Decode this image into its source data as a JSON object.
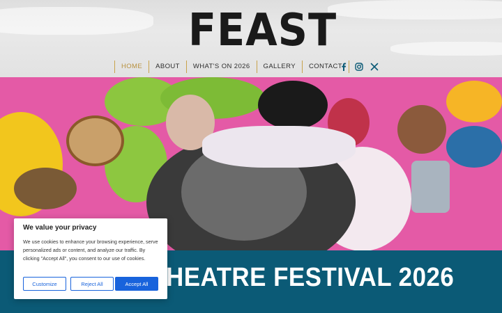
{
  "logo": {
    "text": "FEAST"
  },
  "nav": {
    "items": [
      {
        "label": "HOME",
        "active": true
      },
      {
        "label": "ABOUT"
      },
      {
        "label": "WHAT'S ON 2026"
      },
      {
        "label": "GALLERY"
      },
      {
        "label": "CONTACT"
      }
    ],
    "accent_color": "#b8913f"
  },
  "social": {
    "icons": [
      "facebook-icon",
      "instagram-icon",
      "x-twitter-icon"
    ],
    "color": "#0b5a76"
  },
  "banner": {
    "title": "HEATRE FESTIVAL 2026",
    "background": "#0b5a76"
  },
  "cookie": {
    "title": "We value your privacy",
    "body": "We use cookies to enhance your browsing experience, serve personalized ads or content, and analyze our traffic. By clicking \"Accept All\", you consent to our use of cookies.",
    "buttons": {
      "customize": "Customize",
      "reject": "Reject All",
      "accept": "Accept All"
    },
    "primary_color": "#1863dc"
  }
}
